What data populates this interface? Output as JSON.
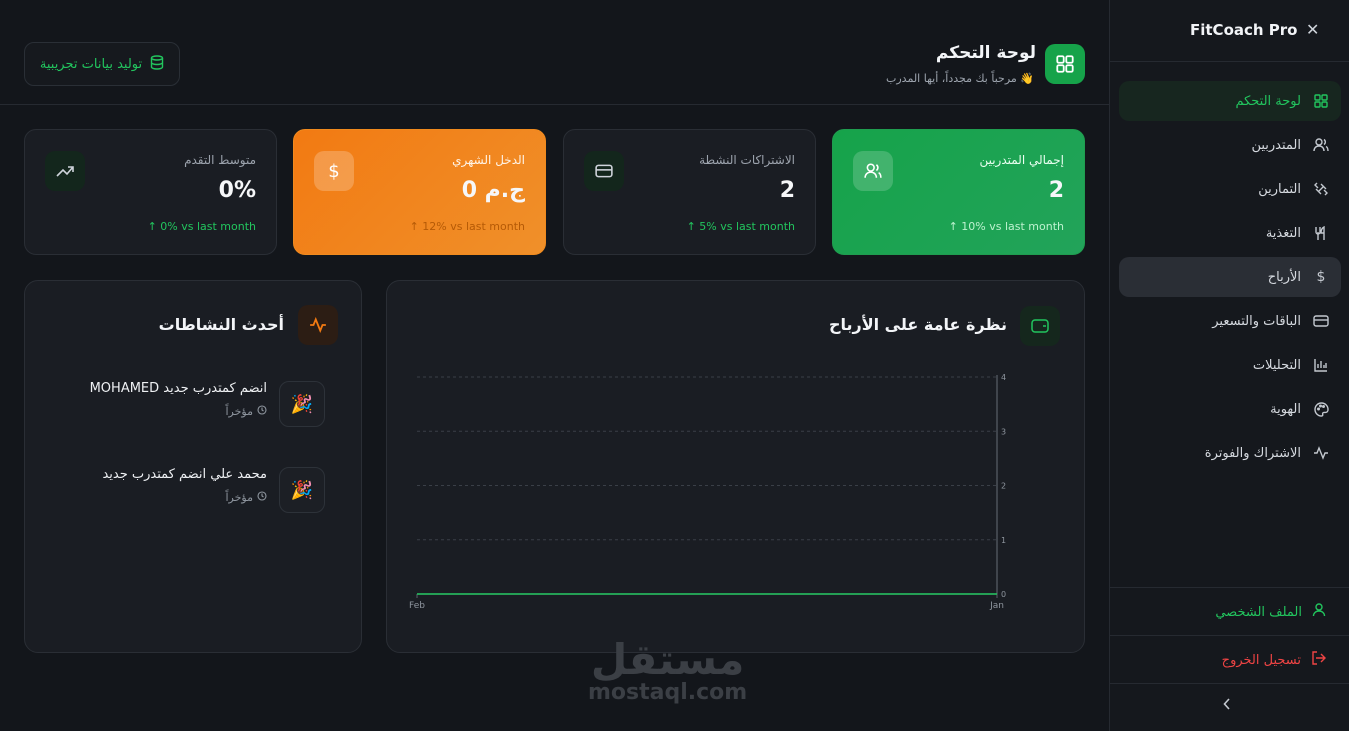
{
  "sidebar": {
    "brand": "FitCoach Pro",
    "close_icon": "x-icon",
    "items": [
      {
        "label": "لوحة التحكم",
        "icon": "grid-icon"
      },
      {
        "label": "المتدربين",
        "icon": "users-icon"
      },
      {
        "label": "التمارين",
        "icon": "dumbbell-icon"
      },
      {
        "label": "التغذية",
        "icon": "utensils-icon"
      },
      {
        "label": "الأرباح",
        "icon": "dollar-icon"
      },
      {
        "label": "الباقات والتسعير",
        "icon": "card-icon"
      },
      {
        "label": "التحليلات",
        "icon": "bar-chart-icon"
      },
      {
        "label": "الهوية",
        "icon": "palette-icon"
      },
      {
        "label": "الاشتراك والفوترة",
        "icon": "activity-icon"
      }
    ],
    "profile_label": "الملف الشخصي",
    "logout_label": "تسجيل الخروج"
  },
  "header": {
    "title": "لوحة التحكم",
    "subtitle": "مرحباً بك مجدداً، أيها المدرب 👋",
    "generate_button": "توليد بيانات تجريبية"
  },
  "stats": [
    {
      "label": "إجمالي المتدربين",
      "value": "2",
      "trend": "↑ 10% vs last month"
    },
    {
      "label": "الاشتراكات النشطة",
      "value": "2",
      "trend": "↑ 5% vs last month"
    },
    {
      "label": "الدخل الشهري",
      "value": "0 ج.م",
      "trend": "↑ 12% vs last month"
    },
    {
      "label": "متوسط التقدم",
      "value": "0%",
      "trend": "↑ 0% vs last month"
    }
  ],
  "earnings_panel": {
    "title": "نظرة عامة على الأرباح"
  },
  "chart_data": {
    "type": "line",
    "x": [
      "Feb",
      "Jan"
    ],
    "series": [
      {
        "values": [
          0,
          0
        ]
      }
    ],
    "y_ticks": [
      "0",
      "1",
      "2",
      "3",
      "4"
    ],
    "ylim": [
      0,
      4
    ],
    "grid": true
  },
  "activity_panel": {
    "title": "أحدث النشاطات",
    "items": [
      {
        "text": "MOHAMED انضم كمتدرب جديد",
        "time": "مؤخراً",
        "icon": "🎉"
      },
      {
        "text": "محمد علي انضم كمتدرب جديد",
        "time": "مؤخراً",
        "icon": "🎉"
      }
    ]
  },
  "watermark": {
    "arabic": "مستقل",
    "latin": "mostaql.com"
  },
  "colors": {
    "accent": "#22c55e",
    "orange": "#f27a12",
    "danger": "#ef4444",
    "bg": "#13161b"
  }
}
